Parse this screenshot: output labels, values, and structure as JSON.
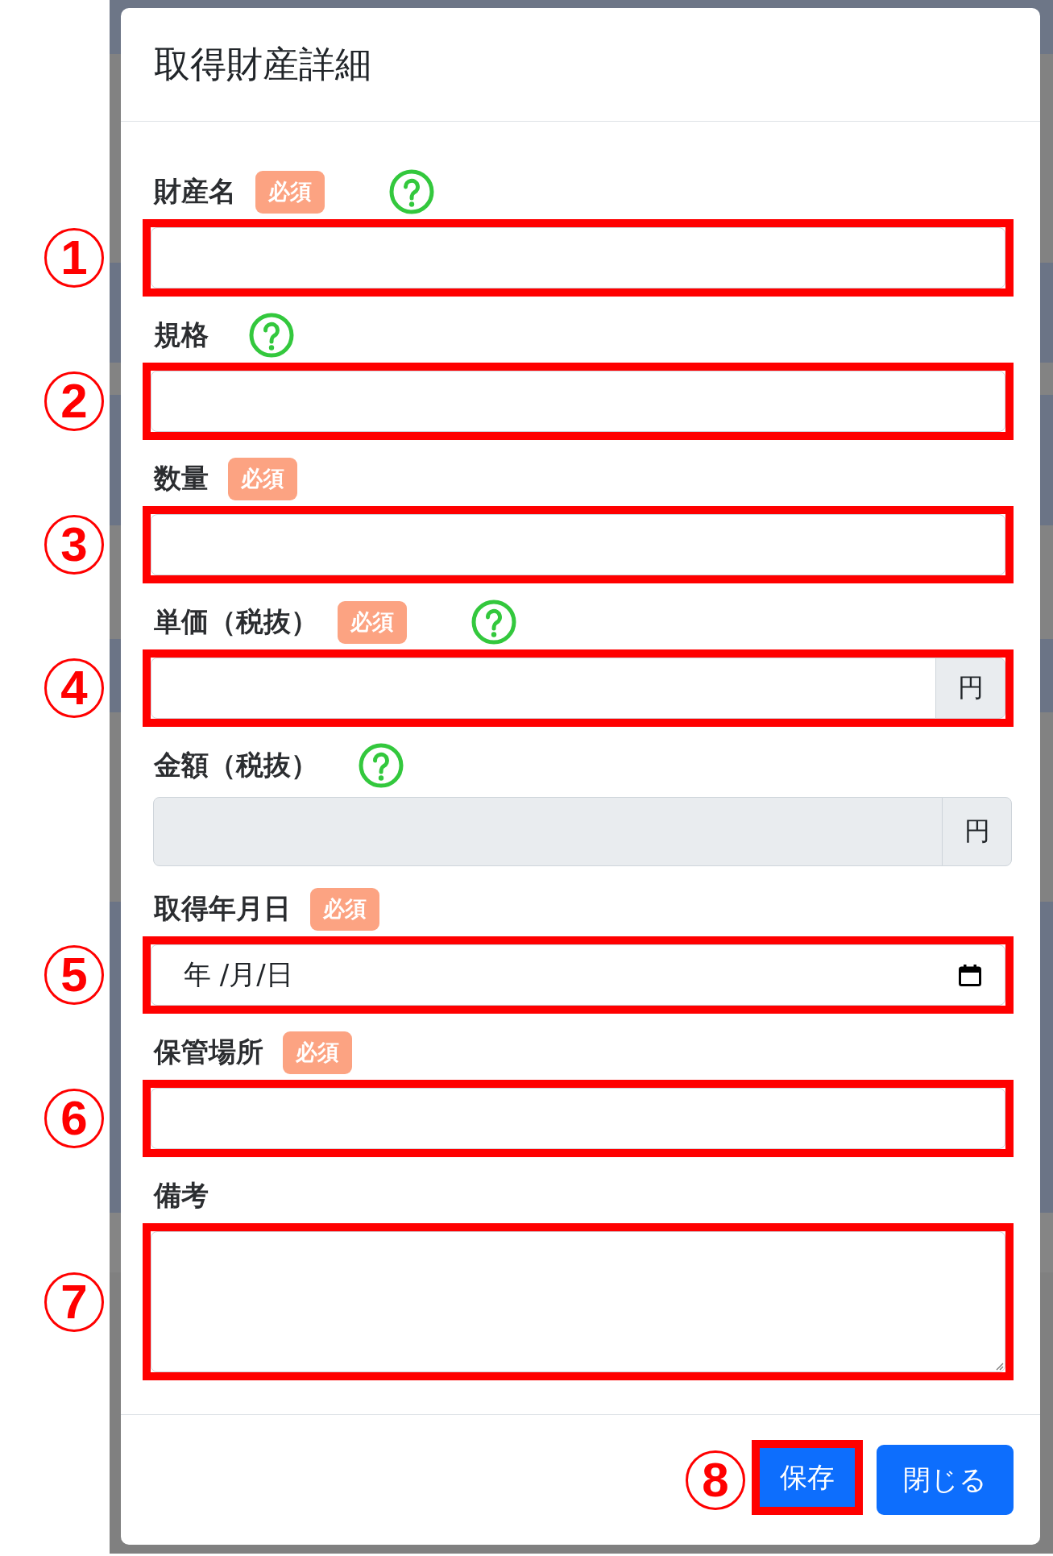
{
  "dialog": {
    "title": "取得財産詳細"
  },
  "fields": [
    {
      "kind": "text",
      "label": "財産名",
      "required_tag": "必須",
      "help": true,
      "marker": "1",
      "disabled": false
    },
    {
      "kind": "text",
      "label": "規格",
      "help": true,
      "marker": "2",
      "disabled": false
    },
    {
      "kind": "text",
      "label": "数量",
      "required_tag": "必須",
      "help": false,
      "marker": "3",
      "disabled": false
    },
    {
      "kind": "currency",
      "label": "単価（税抜）",
      "required_tag": "必須",
      "help": true,
      "marker": "4",
      "unit": "円",
      "disabled": false
    },
    {
      "kind": "currency",
      "label": "金額（税抜）",
      "help": true,
      "unit": "円",
      "disabled": true
    },
    {
      "kind": "date",
      "label": "取得年月日",
      "required_tag": "必須",
      "help": false,
      "marker": "5",
      "placeholder": "年 /月/日",
      "disabled": false
    },
    {
      "kind": "text",
      "label": "保管場所",
      "required_tag": "必須",
      "help": false,
      "marker": "6",
      "disabled": false
    },
    {
      "kind": "textarea",
      "label": "備考",
      "help": false,
      "marker": "7",
      "disabled": false
    }
  ],
  "buttons": [
    {
      "label": "保存",
      "marker": "8"
    },
    {
      "label": "閉じる"
    }
  ]
}
